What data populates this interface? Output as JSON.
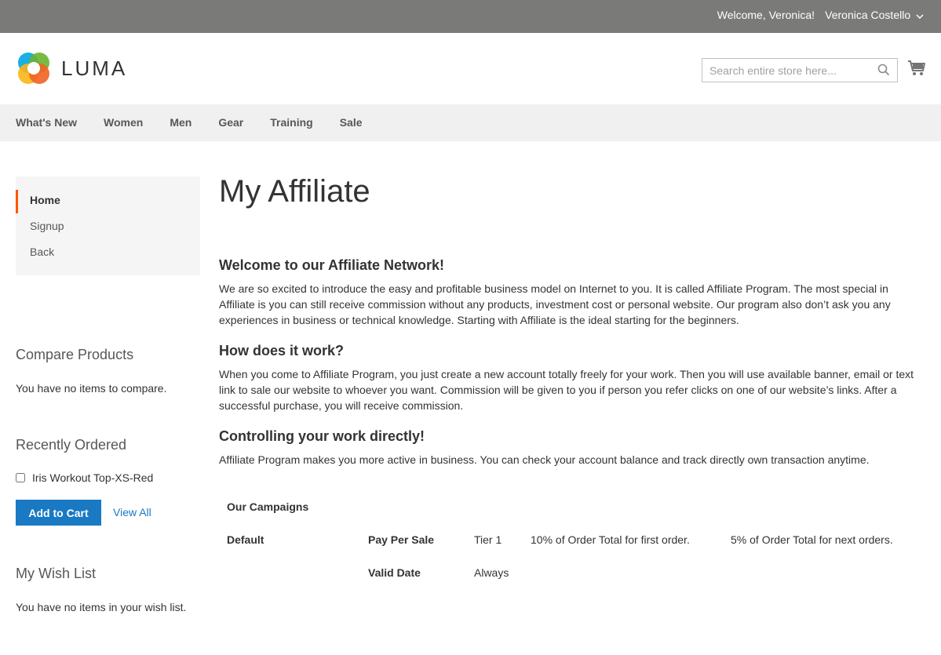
{
  "topbar": {
    "welcome": "Welcome, Veronica!",
    "account_name": "Veronica Costello"
  },
  "header": {
    "logo_text": "LUMA",
    "search_placeholder": "Search entire store here..."
  },
  "nav": {
    "items": [
      "What's New",
      "Women",
      "Men",
      "Gear",
      "Training",
      "Sale"
    ]
  },
  "sidebar": {
    "menu": [
      "Home",
      "Signup",
      "Back"
    ],
    "compare": {
      "title": "Compare Products",
      "empty": "You have no items to compare."
    },
    "recently_ordered": {
      "title": "Recently Ordered",
      "item": "Iris Workout Top-XS-Red",
      "add_to_cart": "Add to Cart",
      "view_all": "View All"
    },
    "wishlist": {
      "title": "My Wish List",
      "empty": "You have no items in your wish list."
    }
  },
  "main": {
    "title": "My Affiliate",
    "sections": [
      {
        "heading": "Welcome to our Affiliate Network!",
        "text": "We are so excited to introduce the easy and profitable business model on Internet to you. It is called Affiliate Program. The most special in Affiliate is you can still receive commission without any products, investment cost or personal website. Our program also don’t ask you any experiences in business or technical knowledge. Starting with Affiliate is the ideal starting for the beginners."
      },
      {
        "heading": "How does it work?",
        "text": "When you come to Affiliate Program, you just create a new account totally freely for your work. Then you will use available banner, email or text link to sale our website to whoever you want. Commission will be given to you if person you refer clicks on one of our website’s links. After a successful purchase, you will receive commission."
      },
      {
        "heading": "Controlling your work directly!",
        "text": "Affiliate Program makes you more active in business. You can check your account balance and track directly own transaction anytime."
      }
    ],
    "campaigns": {
      "title": "Our Campaigns",
      "name": "Default",
      "type_label": "Pay Per Sale",
      "tier": "Tier 1",
      "first_order": "10% of Order Total for first order.",
      "next_orders": "5% of Order Total for next orders.",
      "valid_label": "Valid Date",
      "valid_value": "Always"
    }
  }
}
